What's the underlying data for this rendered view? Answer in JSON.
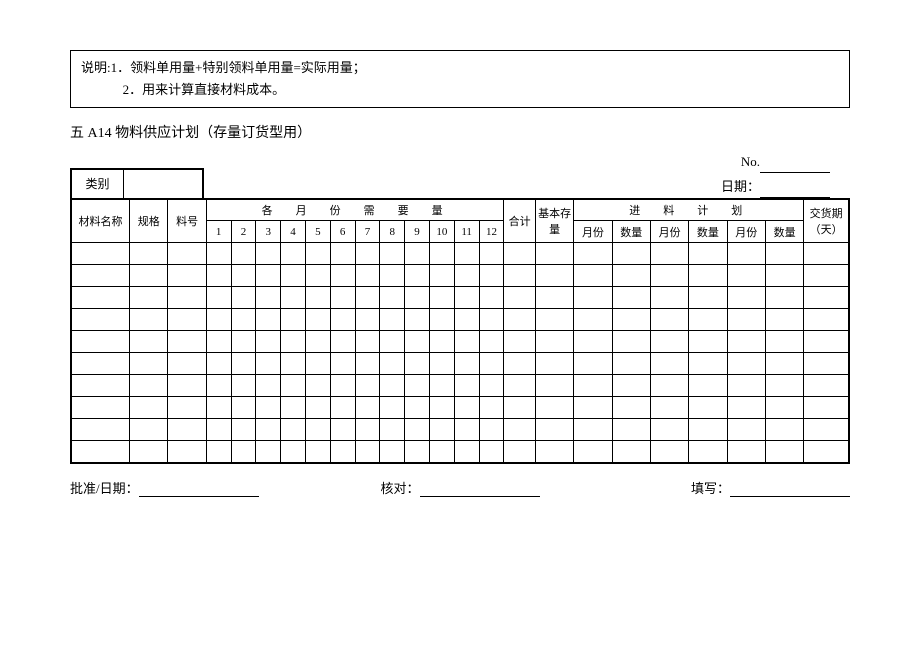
{
  "notes": {
    "prefix": "说明:",
    "line1": "1．领料单用量+特别领料单用量=实际用量；",
    "line2": "2．用来计算直接材料成本。"
  },
  "title": "五 A14  物料供应计划（存量订货型用）",
  "meta": {
    "no_label": "No.",
    "date_label": "日期："
  },
  "category": {
    "label": "类别",
    "value": ""
  },
  "headers": {
    "material_name": "材料名称",
    "spec": "规格",
    "part_no": "料号",
    "monthly_title": "各　月　份　需　要　量",
    "months": [
      "1",
      "2",
      "3",
      "4",
      "5",
      "6",
      "7",
      "8",
      "9",
      "10",
      "11",
      "12"
    ],
    "total": "合计",
    "base_stock": "基本存量",
    "incoming_title": "进　料　计　划",
    "incoming_cols": [
      "月份",
      "数量",
      "月份",
      "数量",
      "月份",
      "数量"
    ],
    "delivery": "交货期（天）"
  },
  "rows": 10,
  "footer": {
    "approve": "批准/日期：",
    "check": "核对：",
    "fill": "填写："
  }
}
